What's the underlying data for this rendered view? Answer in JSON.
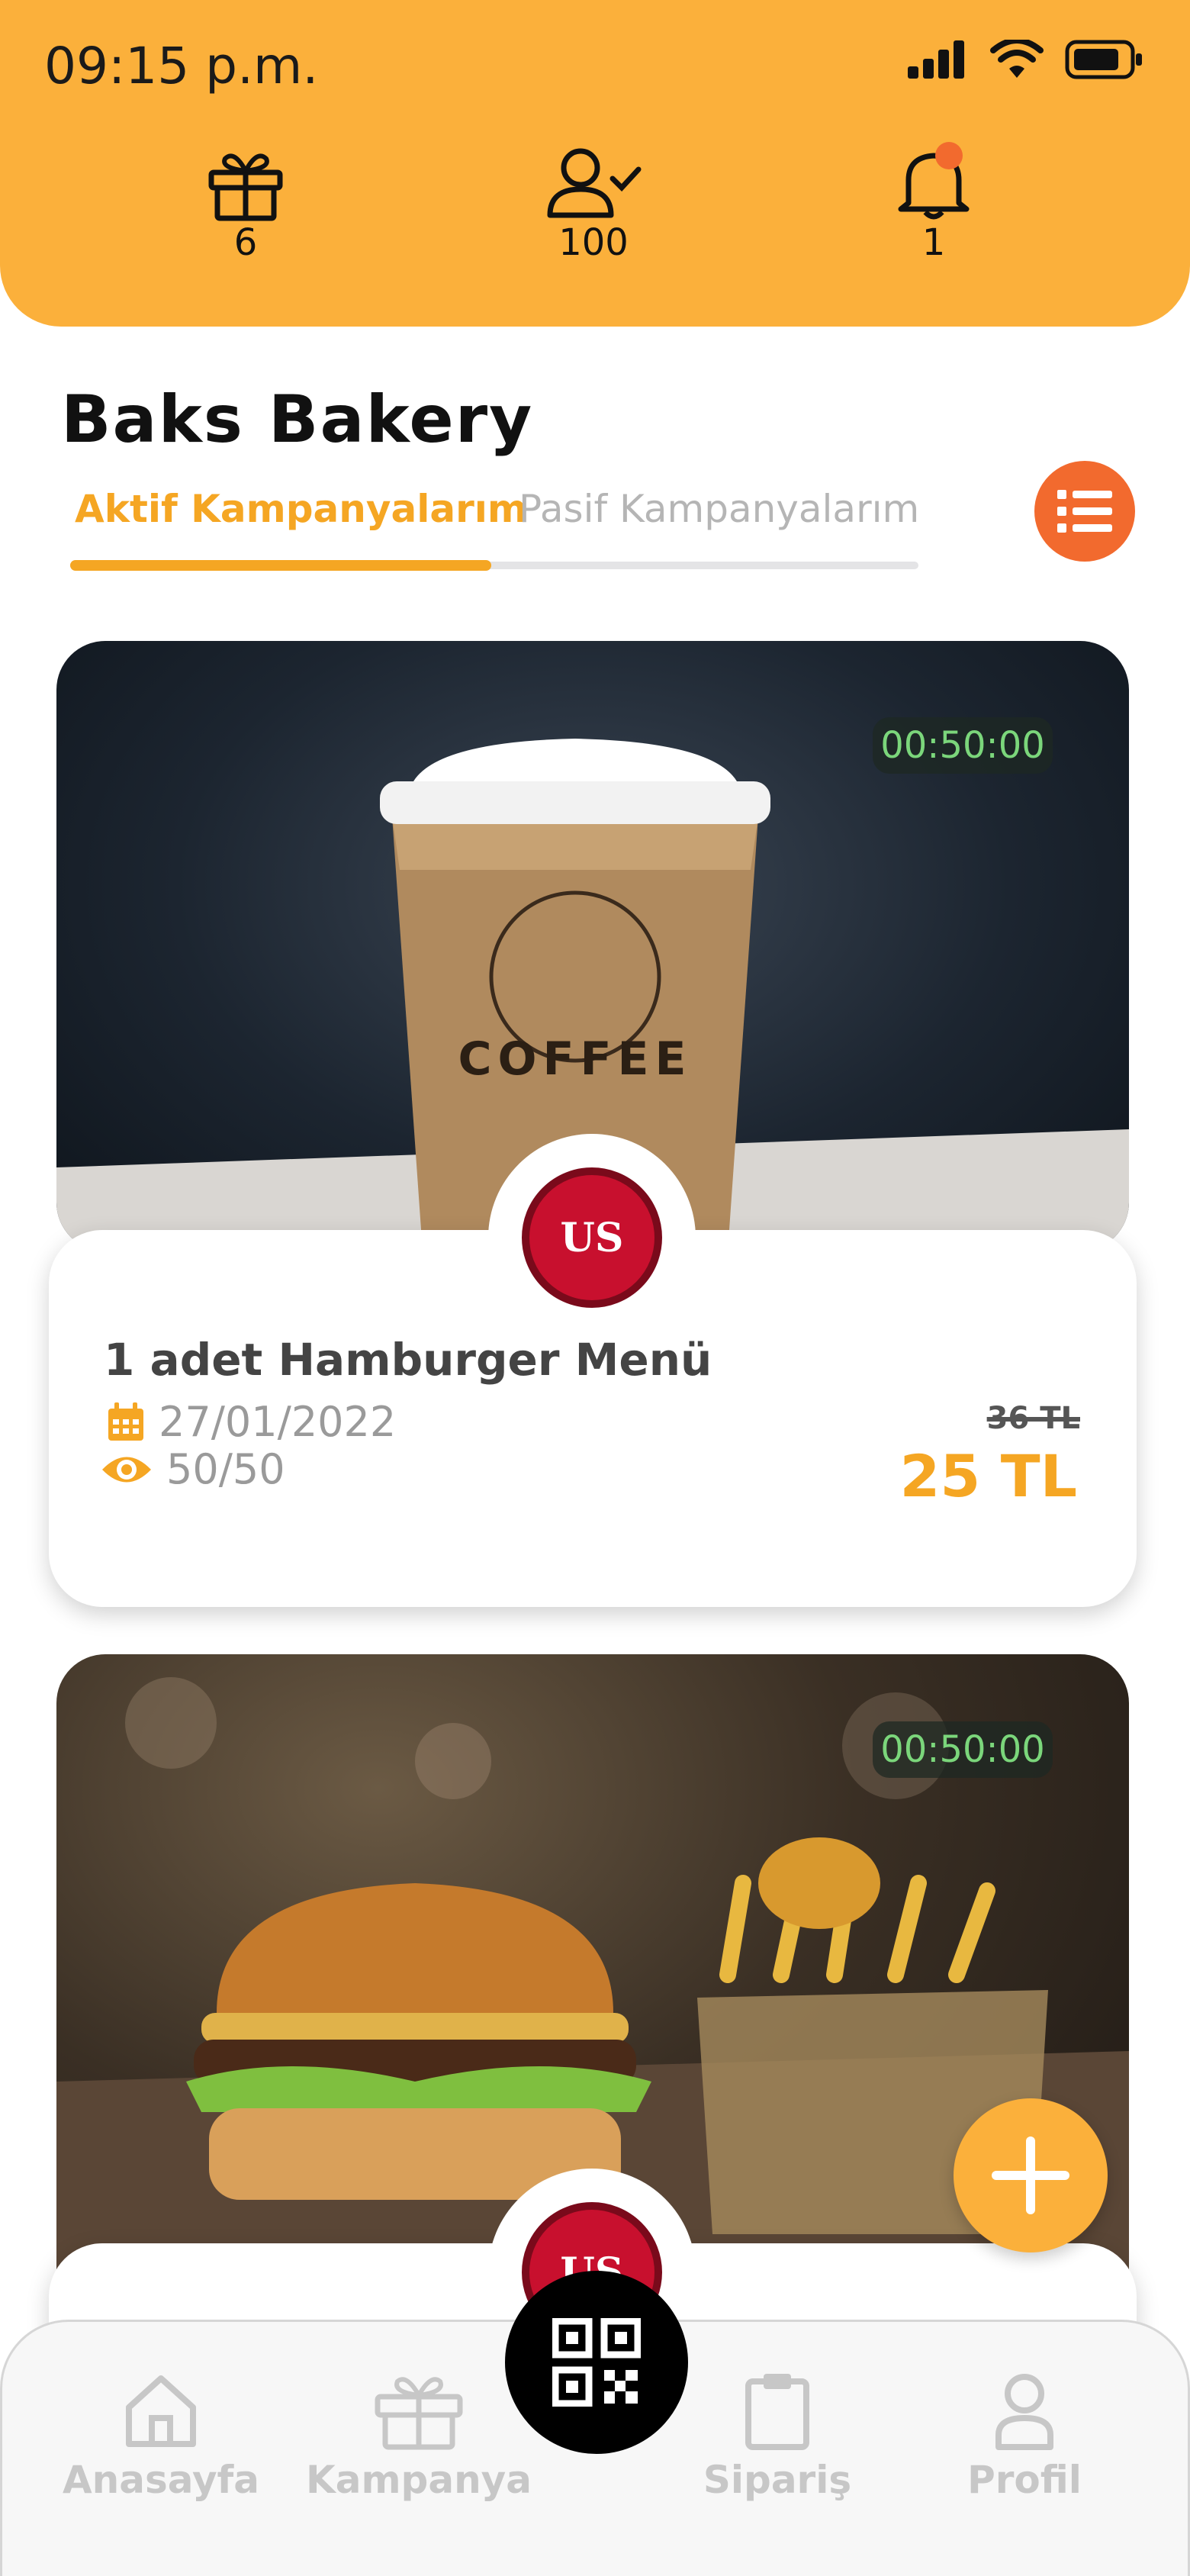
{
  "status_bar": {
    "time": "09:15 p.m."
  },
  "header_stats": [
    {
      "icon": "gift-icon",
      "value": "6"
    },
    {
      "icon": "user-check-icon",
      "value": "100"
    },
    {
      "icon": "bell-icon",
      "value": "1"
    }
  ],
  "page": {
    "title": "Baks Bakery"
  },
  "tabs": {
    "active": "Aktif Kampanyalarım",
    "passive": "Pasif Kampanyalarım"
  },
  "colors": {
    "header": "#fbb03b",
    "accent": "#f5a623",
    "action": "#f26a2e",
    "timer_text": "#7bd67b"
  },
  "campaigns": [
    {
      "timer": "00:50:00",
      "title": "1 adet Hamburger Menü",
      "date": "27/01/2022",
      "views": "50/50",
      "old_price": "36 TL",
      "new_price": "25 TL",
      "logo_text": "US"
    },
    {
      "timer": "00:50:00",
      "logo_text": "US"
    }
  ],
  "nav": {
    "home": "Anasayfa",
    "campaign": "Kampanya",
    "orders": "Sipariş",
    "profile": "Profil"
  }
}
